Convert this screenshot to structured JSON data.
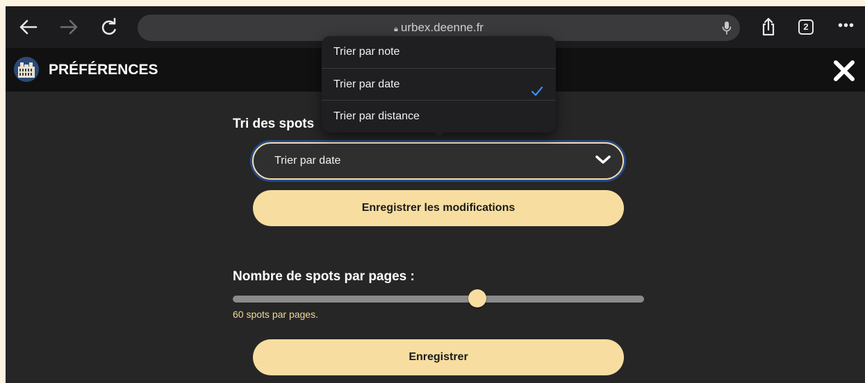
{
  "browser": {
    "url": "urbex.deenne.fr",
    "tab_count": "2"
  },
  "header": {
    "title": "PRÉFÉRENCES"
  },
  "sort": {
    "label": "Tri des spots",
    "selected": "Trier par date",
    "options": [
      "Trier par note",
      "Trier par date",
      "Trier par distance"
    ],
    "save_label": "Enregistrer les modifications"
  },
  "per_page": {
    "label": "Nombre de spots par pages :",
    "value_fraction": 0.595,
    "caption": "60 spots par pages.",
    "save_label": "Enregistrer"
  },
  "colors": {
    "accent": "#f7dea0",
    "focus_ring": "#284b86",
    "checkmark": "#3d8ef7"
  }
}
